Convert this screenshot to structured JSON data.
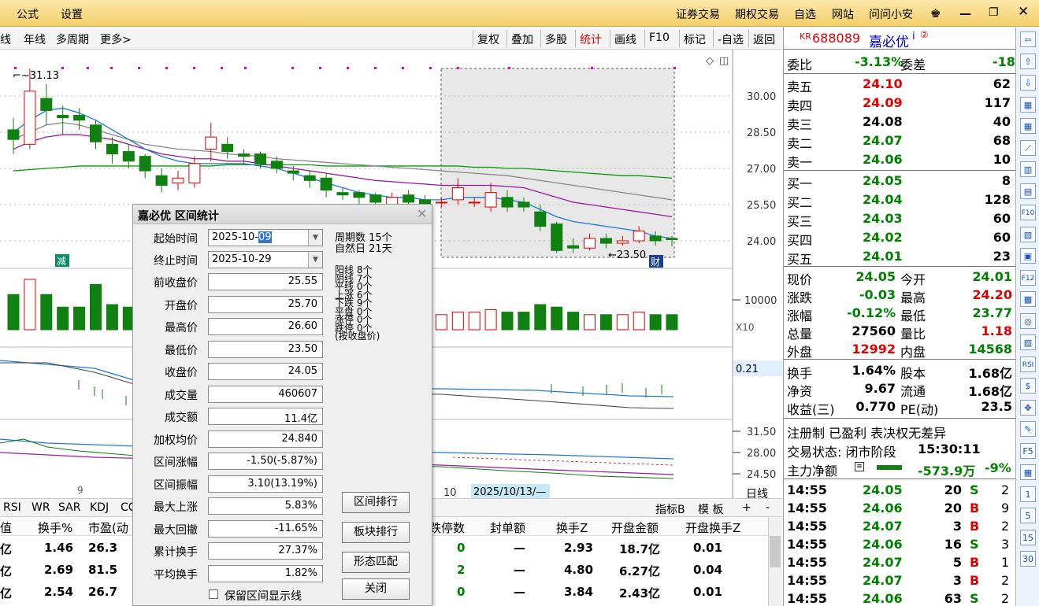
{
  "menu": {
    "left": [
      "公式",
      "设置"
    ],
    "right": [
      "证券交易",
      "期权交易",
      "自选",
      "网站",
      "问问小安"
    ]
  },
  "toolbar": {
    "left": [
      "线",
      "年线",
      "多周期",
      "更多"
    ],
    "buttons": [
      "复权",
      "叠加",
      "多股",
      "统计",
      "画线",
      "F10",
      "标记",
      "-自选",
      "返回"
    ],
    "active": "统计"
  },
  "chart": {
    "price_high_label": "31.13",
    "price_low_label": "23.50",
    "y_ticks": [
      "30.00",
      "28.50",
      "27.00",
      "25.50",
      "24.00"
    ],
    "vol_tick": "10000",
    "vol_mult": "X10",
    "ind1_value": "0.21",
    "ind2_ticks": [
      "31.50",
      "28.00",
      "24.50"
    ],
    "x_date_left": "9",
    "x_date_mid": "10",
    "x_date_cursor": "2025/10/13/—",
    "badge_jian": "减",
    "badge_cai": "财",
    "candles": [
      {
        "o": 28.6,
        "c": 28.2,
        "h": 29.1,
        "l": 27.6
      },
      {
        "o": 28.0,
        "c": 30.2,
        "h": 31.13,
        "l": 27.8
      },
      {
        "o": 29.9,
        "c": 29.4,
        "h": 30.5,
        "l": 28.8
      },
      {
        "o": 29.2,
        "c": 29.1,
        "h": 29.6,
        "l": 28.4
      },
      {
        "o": 29.2,
        "c": 29.0,
        "h": 29.5,
        "l": 28.6
      },
      {
        "o": 28.8,
        "c": 28.1,
        "h": 29.0,
        "l": 27.8
      },
      {
        "o": 28.0,
        "c": 27.6,
        "h": 28.3,
        "l": 27.2
      },
      {
        "o": 27.7,
        "c": 27.3,
        "h": 28.0,
        "l": 27.0
      },
      {
        "o": 27.5,
        "c": 26.9,
        "h": 27.6,
        "l": 26.6
      },
      {
        "o": 26.7,
        "c": 26.3,
        "h": 27.0,
        "l": 26.0
      },
      {
        "o": 26.4,
        "c": 26.6,
        "h": 26.9,
        "l": 26.1
      },
      {
        "o": 26.4,
        "c": 27.2,
        "h": 27.5,
        "l": 26.2
      },
      {
        "o": 27.8,
        "c": 28.3,
        "h": 28.9,
        "l": 27.3
      },
      {
        "o": 28.0,
        "c": 27.7,
        "h": 28.3,
        "l": 27.4
      },
      {
        "o": 27.6,
        "c": 27.5,
        "h": 27.8,
        "l": 27.2
      },
      {
        "o": 27.6,
        "c": 27.2,
        "h": 27.7,
        "l": 27.0
      },
      {
        "o": 27.3,
        "c": 27.0,
        "h": 27.5,
        "l": 26.8
      },
      {
        "o": 26.9,
        "c": 26.8,
        "h": 27.1,
        "l": 26.5
      },
      {
        "o": 26.7,
        "c": 26.5,
        "h": 26.9,
        "l": 26.2
      },
      {
        "o": 26.6,
        "c": 26.1,
        "h": 26.8,
        "l": 25.8
      },
      {
        "o": 26.0,
        "c": 25.9,
        "h": 26.2,
        "l": 25.7
      },
      {
        "o": 26.0,
        "c": 25.8,
        "h": 26.1,
        "l": 25.5
      },
      {
        "o": 25.9,
        "c": 25.6,
        "h": 26.0,
        "l": 25.4
      },
      {
        "o": 25.5,
        "c": 25.8,
        "h": 26.0,
        "l": 25.3
      },
      {
        "o": 25.9,
        "c": 25.6,
        "h": 26.1,
        "l": 25.4
      },
      {
        "o": 25.7,
        "c": 25.4,
        "h": 25.9,
        "l": 25.2
      },
      {
        "o": 25.6,
        "c": 25.6,
        "h": 25.8,
        "l": 25.4
      },
      {
        "o": 25.7,
        "c": 26.2,
        "h": 26.6,
        "l": 25.5
      },
      {
        "o": 25.6,
        "c": 25.6,
        "h": 25.8,
        "l": 25.4
      },
      {
        "o": 25.4,
        "c": 26.0,
        "h": 26.4,
        "l": 25.2
      },
      {
        "o": 25.8,
        "c": 25.4,
        "h": 26.1,
        "l": 25.2
      },
      {
        "o": 25.6,
        "c": 25.4,
        "h": 25.8,
        "l": 25.2
      },
      {
        "o": 25.2,
        "c": 24.6,
        "h": 25.5,
        "l": 24.4
      },
      {
        "o": 24.7,
        "c": 23.6,
        "h": 24.8,
        "l": 23.5
      },
      {
        "o": 23.8,
        "c": 23.7,
        "h": 24.1,
        "l": 23.5
      },
      {
        "o": 23.7,
        "c": 24.1,
        "h": 24.3,
        "l": 23.6
      },
      {
        "o": 24.1,
        "c": 23.9,
        "h": 24.3,
        "l": 23.7
      },
      {
        "o": 23.9,
        "c": 24.0,
        "h": 24.2,
        "l": 23.8
      },
      {
        "o": 24.0,
        "c": 24.4,
        "h": 24.6,
        "l": 23.9
      },
      {
        "o": 24.2,
        "c": 24.0,
        "h": 24.4,
        "l": 23.8
      },
      {
        "o": 24.1,
        "c": 24.05,
        "h": 24.2,
        "l": 23.77
      }
    ],
    "volumes": [
      14,
      20,
      14,
      9,
      9,
      18,
      10,
      9,
      9,
      8,
      8,
      7,
      8,
      8,
      8,
      7,
      7,
      7,
      6,
      8,
      7,
      6,
      7,
      7,
      6,
      6,
      6,
      7,
      7,
      8,
      7,
      7,
      10,
      9,
      7,
      6,
      6,
      6,
      7,
      6,
      6
    ],
    "ma_gray": [
      28.2,
      28.5,
      28.8,
      28.9,
      28.8,
      28.6,
      28.4,
      28.2,
      28.0,
      27.9,
      27.8,
      27.75,
      27.7,
      27.6,
      27.55,
      27.5,
      27.4,
      27.35,
      27.3,
      27.25,
      27.2,
      27.15,
      27.1,
      27.05,
      27.0,
      26.95,
      26.9,
      26.85,
      26.8,
      26.75,
      26.7,
      26.6,
      26.5,
      26.4,
      26.3,
      26.2,
      26.1,
      26.0,
      25.9,
      25.8,
      25.7
    ],
    "ma_green": [
      26.9,
      26.95,
      27.0,
      27.05,
      27.1,
      27.1,
      27.1,
      27.1,
      27.1,
      27.1,
      27.1,
      27.1,
      27.1,
      27.15,
      27.15,
      27.15,
      27.15,
      27.15,
      27.15,
      27.1,
      27.1,
      27.1,
      27.1,
      27.1,
      27.1,
      27.1,
      27.1,
      27.1,
      27.05,
      27.05,
      27.0,
      27.0,
      26.95,
      26.9,
      26.85,
      26.8,
      26.75,
      26.7,
      26.7,
      26.65,
      26.6
    ],
    "ma_purple": [
      27.8,
      28.1,
      28.3,
      28.4,
      28.4,
      28.3,
      28.2,
      28.0,
      27.8,
      27.6,
      27.5,
      27.4,
      27.4,
      27.3,
      27.3,
      27.2,
      27.1,
      27.0,
      26.9,
      26.8,
      26.7,
      26.6,
      26.5,
      26.45,
      26.4,
      26.35,
      26.3,
      26.3,
      26.3,
      26.3,
      26.25,
      26.2,
      26.0,
      25.8,
      25.6,
      25.5,
      25.4,
      25.3,
      25.2,
      25.1,
      25.0
    ],
    "ma_blue": [
      28.5,
      29.0,
      29.4,
      29.5,
      29.3,
      29.0,
      28.6,
      28.2,
      27.8,
      27.5,
      27.3,
      27.2,
      27.2,
      27.2,
      27.2,
      27.1,
      27.0,
      26.8,
      26.6,
      26.4,
      26.2,
      26.0,
      25.9,
      25.8,
      25.8,
      25.7,
      25.7,
      25.8,
      25.8,
      25.8,
      25.7,
      25.6,
      25.3,
      25.0,
      24.8,
      24.7,
      24.6,
      24.5,
      24.4,
      24.2,
      24.1
    ]
  },
  "dialog": {
    "title": "嘉必优 区间统计",
    "start_label": "起始时间",
    "start_value": "2025-10-",
    "start_sel": "09",
    "end_label": "终止时间",
    "end_value": "2025-10-29",
    "fields": [
      {
        "label": "前收盘价",
        "value": "25.55"
      },
      {
        "label": "开盘价",
        "value": "25.70"
      },
      {
        "label": "最高价",
        "value": "26.60"
      },
      {
        "label": "最低价",
        "value": "23.50"
      },
      {
        "label": "收盘价",
        "value": "24.05"
      },
      {
        "label": "成交量",
        "value": "460607"
      },
      {
        "label": "成交额",
        "value": "11.4亿"
      },
      {
        "label": "加权均价",
        "value": "24.840"
      },
      {
        "label": "区间涨幅",
        "value": "-1.50(-5.87%)"
      },
      {
        "label": "区间振幅",
        "value": "3.10(13.19%)"
      },
      {
        "label": "最大上涨",
        "value": "5.83%"
      },
      {
        "label": "最大回撤",
        "value": "-11.65%"
      },
      {
        "label": "累计换手",
        "value": "27.37%"
      },
      {
        "label": "平均换手",
        "value": "1.82%"
      }
    ],
    "period_count": "周期数 15个",
    "natural_days": "自然日 21天",
    "stats": [
      "阳线 8个",
      "阴线 7个",
      "平线 0个",
      "上涨 6个",
      "下跌 9个",
      "平盘 0个",
      "涨停 0个",
      "跌停 0个",
      "(按收盘价)"
    ],
    "buttons": [
      "区间排行",
      "板块排行",
      "形态匹配",
      "关闭"
    ],
    "checkbox": "保留区间显示线"
  },
  "bottom": {
    "tabs": [
      "RSI",
      "WR",
      "SAR",
      "KDJ",
      "CC"
    ],
    "btns": [
      "指标B",
      "模 板",
      "+",
      "-"
    ],
    "right_label": "日线",
    "headers": [
      "值",
      "换手%",
      "市盈(动",
      "跌停数",
      "封单额",
      "换手Z",
      "开盘金额",
      "开盘换手Z"
    ],
    "rows": [
      [
        "亿",
        "1.46",
        "26.3",
        "0",
        "—",
        "2.93",
        "18.7亿",
        "0.01"
      ],
      [
        "亿",
        "2.69",
        "81.5",
        "2",
        "—",
        "4.80",
        "6.27亿",
        "0.04"
      ],
      [
        "亿",
        "2.54",
        "26.7",
        "0",
        "—",
        "3.84",
        "2.43亿",
        "0.01"
      ]
    ]
  },
  "quote": {
    "tag": "KR",
    "code": "688089",
    "name": "嘉必优",
    "weibi_label": "委比",
    "weibi": "-3.13%",
    "weicha_label": "委差",
    "weicha": "-18",
    "sell": [
      {
        "label": "卖五",
        "price": "24.10",
        "vol": "62",
        "pc": "red"
      },
      {
        "label": "卖四",
        "price": "24.09",
        "vol": "117",
        "pc": "red"
      },
      {
        "label": "卖三",
        "price": "24.08",
        "vol": "40",
        "pc": "blk"
      },
      {
        "label": "卖二",
        "price": "24.07",
        "vol": "68",
        "pc": "grn"
      },
      {
        "label": "卖一",
        "price": "24.06",
        "vol": "10",
        "pc": "grn"
      }
    ],
    "buy": [
      {
        "label": "买一",
        "price": "24.05",
        "vol": "8"
      },
      {
        "label": "买二",
        "price": "24.04",
        "vol": "128"
      },
      {
        "label": "买三",
        "price": "24.03",
        "vol": "60"
      },
      {
        "label": "买四",
        "price": "24.02",
        "vol": "60"
      },
      {
        "label": "买五",
        "price": "24.01",
        "vol": "23"
      }
    ],
    "info": [
      {
        "l1": "现价",
        "v1": "24.05",
        "c1": "grn",
        "l2": "今开",
        "v2": "24.01",
        "c2": "grn"
      },
      {
        "l1": "涨跌",
        "v1": "-0.03",
        "c1": "grn",
        "l2": "最高",
        "v2": "24.20",
        "c2": "red"
      },
      {
        "l1": "涨幅",
        "v1": "-0.12%",
        "c1": "grn",
        "l2": "最低",
        "v2": "23.77",
        "c2": "grn"
      },
      {
        "l1": "总量",
        "v1": "27560",
        "c1": "blk",
        "l2": "量比",
        "v2": "1.18",
        "c2": "red"
      },
      {
        "l1": "外盘",
        "v1": "12992",
        "c1": "red",
        "l2": "内盘",
        "v2": "14568",
        "c2": "grn"
      }
    ],
    "info2": [
      {
        "l1": "换手",
        "v1": "1.64%",
        "l2": "股本",
        "v2": "1.68亿"
      },
      {
        "l1": "净资",
        "v1": "9.67",
        "l2": "流通",
        "v2": "1.68亿"
      },
      {
        "l1": "收益(三)",
        "v1": "0.770",
        "l2": "PE(动)",
        "v2": "23.5"
      }
    ],
    "tags_line": "注册制 已盈利 表决权无差异",
    "status_label": "交易状态: 闭市阶段",
    "status_time": "15:30:11",
    "main_label": "主力净额",
    "main_value": "-573.9万",
    "main_pct": "-9%",
    "ticks": [
      {
        "t": "14:55",
        "p": "24.05",
        "v": "20",
        "bs": "S",
        "n": "2",
        "pc": "grn"
      },
      {
        "t": "14:55",
        "p": "24.06",
        "v": "20",
        "bs": "B",
        "n": "9",
        "pc": "grn"
      },
      {
        "t": "14:55",
        "p": "24.07",
        "v": "3",
        "bs": "B",
        "n": "2",
        "pc": "grn"
      },
      {
        "t": "14:55",
        "p": "24.06",
        "v": "16",
        "bs": "S",
        "n": "3",
        "pc": "grn"
      },
      {
        "t": "14:55",
        "p": "24.07",
        "v": "5",
        "bs": "B",
        "n": "1",
        "pc": "grn"
      },
      {
        "t": "14:55",
        "p": "24.07",
        "v": "3",
        "bs": "B",
        "n": "2",
        "pc": "grn"
      },
      {
        "t": "14:55",
        "p": "24.06",
        "v": "63",
        "bs": "S",
        "n": "2",
        "pc": "grn"
      }
    ]
  },
  "side_icons": [
    "⇦",
    "⇧",
    "⇩",
    "▦",
    "▦",
    "⟋",
    "▥",
    "▤",
    "F10",
    "▧",
    "▣",
    "F12",
    "▩",
    "◎",
    "▨",
    "RSI",
    "$",
    "✥",
    "✎",
    "F5",
    "▦",
    "1",
    "5",
    "15",
    "30"
  ],
  "colors": {
    "up": "#e00000",
    "down": "#008000",
    "accent": "#0000c8"
  }
}
